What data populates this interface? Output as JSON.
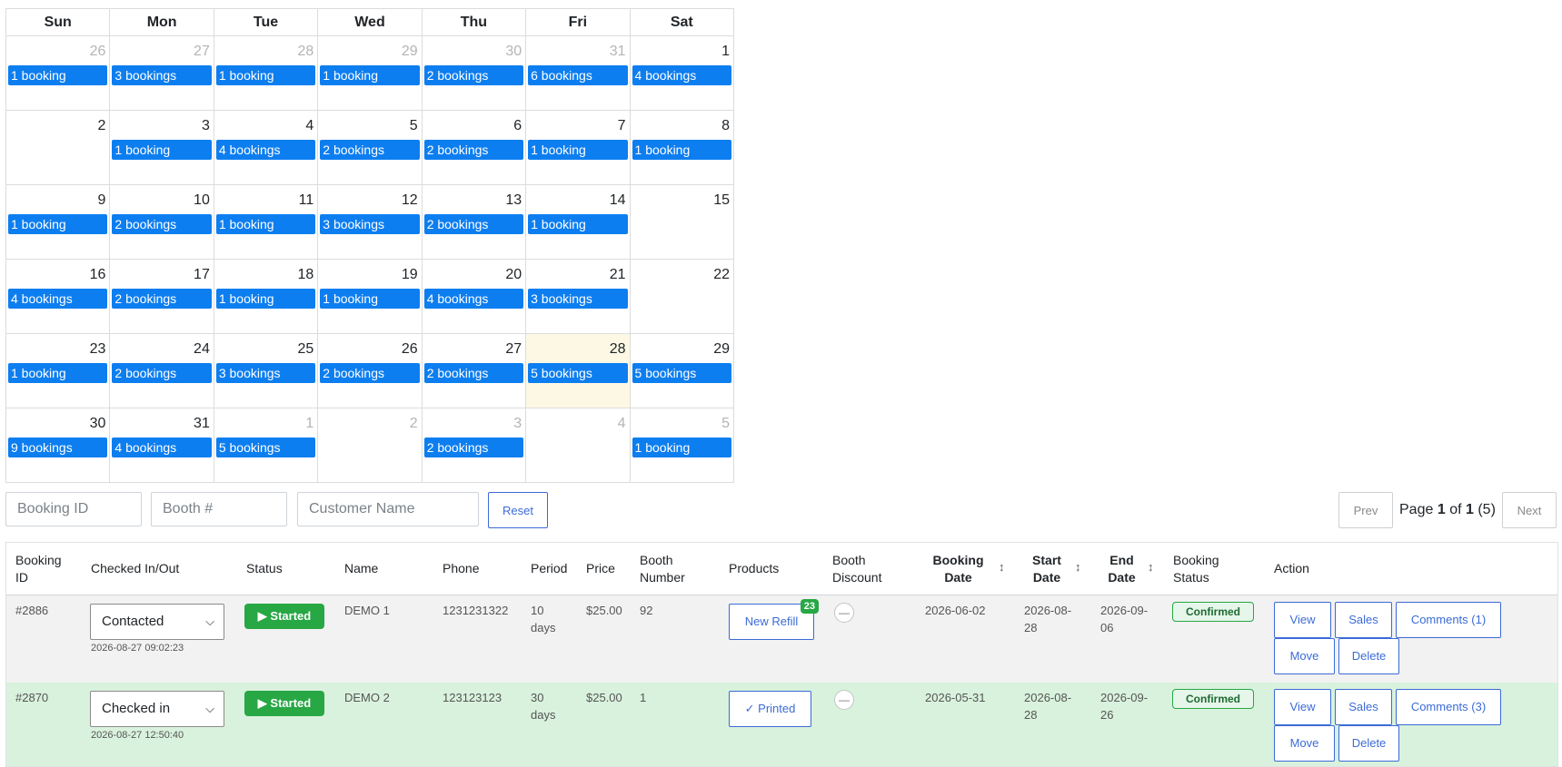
{
  "calendar": {
    "weekdays": [
      "Sun",
      "Mon",
      "Tue",
      "Wed",
      "Thu",
      "Fri",
      "Sat"
    ],
    "weeks": [
      [
        {
          "day": "26",
          "muted": true,
          "ev": "1 booking"
        },
        {
          "day": "27",
          "muted": true,
          "ev": "3 bookings"
        },
        {
          "day": "28",
          "muted": true,
          "ev": "1 booking"
        },
        {
          "day": "29",
          "muted": true,
          "ev": "1 booking"
        },
        {
          "day": "30",
          "muted": true,
          "ev": "2 bookings"
        },
        {
          "day": "31",
          "muted": true,
          "ev": "6 bookings"
        },
        {
          "day": "1",
          "muted": false,
          "ev": "4 bookings"
        }
      ],
      [
        {
          "day": "2",
          "muted": false,
          "ev": ""
        },
        {
          "day": "3",
          "muted": false,
          "ev": "1 booking"
        },
        {
          "day": "4",
          "muted": false,
          "ev": "4 bookings"
        },
        {
          "day": "5",
          "muted": false,
          "ev": "2 bookings"
        },
        {
          "day": "6",
          "muted": false,
          "ev": "2 bookings"
        },
        {
          "day": "7",
          "muted": false,
          "ev": "1 booking"
        },
        {
          "day": "8",
          "muted": false,
          "ev": "1 booking"
        }
      ],
      [
        {
          "day": "9",
          "muted": false,
          "ev": "1 booking"
        },
        {
          "day": "10",
          "muted": false,
          "ev": "2 bookings"
        },
        {
          "day": "11",
          "muted": false,
          "ev": "1 booking"
        },
        {
          "day": "12",
          "muted": false,
          "ev": "3 bookings"
        },
        {
          "day": "13",
          "muted": false,
          "ev": "2 bookings"
        },
        {
          "day": "14",
          "muted": false,
          "ev": "1 booking"
        },
        {
          "day": "15",
          "muted": false,
          "ev": ""
        }
      ],
      [
        {
          "day": "16",
          "muted": false,
          "ev": "4 bookings"
        },
        {
          "day": "17",
          "muted": false,
          "ev": "2 bookings"
        },
        {
          "day": "18",
          "muted": false,
          "ev": "1 booking"
        },
        {
          "day": "19",
          "muted": false,
          "ev": "1 booking"
        },
        {
          "day": "20",
          "muted": false,
          "ev": "4 bookings"
        },
        {
          "day": "21",
          "muted": false,
          "ev": "3 bookings"
        },
        {
          "day": "22",
          "muted": false,
          "ev": ""
        }
      ],
      [
        {
          "day": "23",
          "muted": false,
          "ev": "1 booking"
        },
        {
          "day": "24",
          "muted": false,
          "ev": "2 bookings"
        },
        {
          "day": "25",
          "muted": false,
          "ev": "3 bookings"
        },
        {
          "day": "26",
          "muted": false,
          "ev": "2 bookings"
        },
        {
          "day": "27",
          "muted": false,
          "ev": "2 bookings"
        },
        {
          "day": "28",
          "muted": false,
          "ev": "5 bookings",
          "today": true
        },
        {
          "day": "29",
          "muted": false,
          "ev": "5 bookings"
        }
      ],
      [
        {
          "day": "30",
          "muted": false,
          "ev": "9 bookings"
        },
        {
          "day": "31",
          "muted": false,
          "ev": "4 bookings"
        },
        {
          "day": "1",
          "muted": true,
          "ev": "5 bookings"
        },
        {
          "day": "2",
          "muted": true,
          "ev": ""
        },
        {
          "day": "3",
          "muted": true,
          "ev": "2 bookings"
        },
        {
          "day": "4",
          "muted": true,
          "ev": ""
        },
        {
          "day": "5",
          "muted": true,
          "ev": "1 booking"
        }
      ]
    ],
    "event_color": "#0d7ef0",
    "today_color": "#fcf8e3"
  },
  "filters": {
    "booking_id_placeholder": "Booking ID",
    "booth_placeholder": "Booth #",
    "customer_placeholder": "Customer Name",
    "reset_label": "Reset"
  },
  "pager": {
    "prev_label": "Prev",
    "next_label": "Next",
    "page_word": "Page",
    "page": "1",
    "of_word": "of",
    "total_pages": "1",
    "count": "(5)"
  },
  "table": {
    "headers": {
      "booking_id": "Booking ID",
      "checked": "Checked In/Out",
      "status": "Status",
      "name": "Name",
      "phone": "Phone",
      "period": "Period",
      "price": "Price",
      "booth_number": "Booth Number",
      "products": "Products",
      "booth_discount": "Booth Discount",
      "booking_date": "Booking Date",
      "start_date": "Start Date",
      "end_date": "End Date",
      "booking_status": "Booking Status",
      "action": "Action",
      "sort_icon": "↕"
    },
    "rows": [
      {
        "id": "#2886",
        "checked": "Contacted",
        "checked_time": "2026-08-27 09:02:23",
        "status": "Started",
        "name": "DEMO 1",
        "phone": "1231231322",
        "period": "10 days",
        "price": "$25.00",
        "booth": "92",
        "product_label": "New Refill",
        "product_badge": "23",
        "discount": "—",
        "booking_date": "2026-06-02",
        "start_date": "2026-08-28",
        "end_date": "2026-09-06",
        "booking_status": "Confirmed",
        "view": "View",
        "sales": "Sales",
        "comments": "Comments (1)",
        "move": "Move",
        "delete": "Delete"
      },
      {
        "id": "#2870",
        "checked": "Checked in",
        "checked_time": "2026-08-27 12:50:40",
        "status": "Started",
        "name": "DEMO 2",
        "phone": "123123123",
        "period": "30 days",
        "price": "$25.00",
        "booth": "1",
        "product_label": "✓ Printed",
        "product_badge": "",
        "discount": "—",
        "booking_date": "2026-05-31",
        "start_date": "2026-08-28",
        "end_date": "2026-09-26",
        "booking_status": "Confirmed",
        "view": "View",
        "sales": "Sales",
        "comments": "Comments (3)",
        "move": "Move",
        "delete": "Delete"
      }
    ]
  }
}
